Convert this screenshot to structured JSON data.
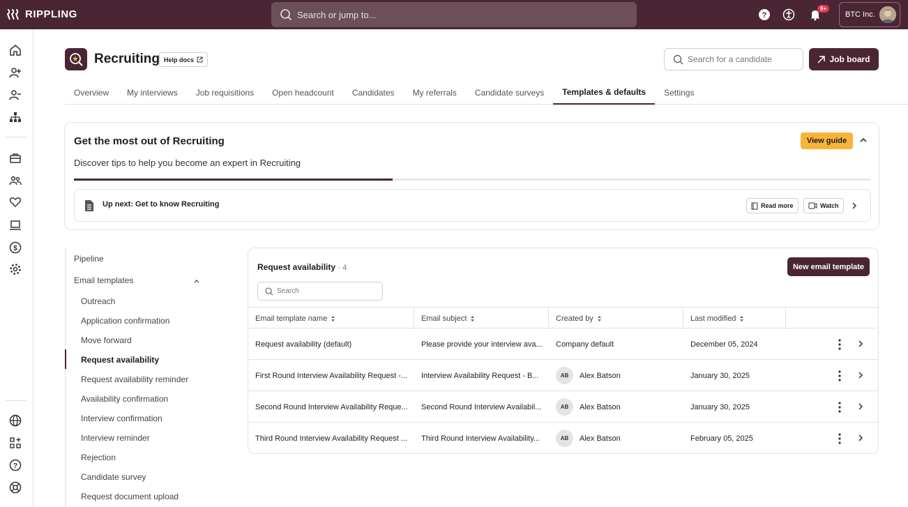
{
  "topbar": {
    "brand": "RIPPLING",
    "search_placeholder": "Search or jump to...",
    "notification_badge": "9+",
    "company": "BTC Inc."
  },
  "sidebar": {
    "icons": [
      "home-icon",
      "person-add-icon",
      "person-remove-icon",
      "org-chart-icon",
      "briefcase-icon",
      "people-icon",
      "heart-icon",
      "laptop-icon",
      "dollar-icon",
      "gear-icon",
      "globe-icon",
      "apps-add-icon",
      "help-icon",
      "support-icon"
    ]
  },
  "header": {
    "title": "Recruiting",
    "help_docs": "Help docs",
    "candidate_search_placeholder": "Search for a candidate",
    "job_board": "Job board"
  },
  "tabs": [
    {
      "label": "Overview",
      "active": false
    },
    {
      "label": "My interviews",
      "active": false
    },
    {
      "label": "Job requisitions",
      "active": false
    },
    {
      "label": "Open headcount",
      "active": false
    },
    {
      "label": "Candidates",
      "active": false
    },
    {
      "label": "My referrals",
      "active": false
    },
    {
      "label": "Candidate surveys",
      "active": false
    },
    {
      "label": "Templates & defaults",
      "active": true
    },
    {
      "label": "Settings",
      "active": false
    }
  ],
  "guide": {
    "title": "Get the most out of Recruiting",
    "subtitle": "Discover tips to help you become an expert in Recruiting",
    "view_guide": "View guide",
    "progress": 0.4,
    "up_next": "Up next: Get to know Recruiting",
    "read_more": "Read more",
    "watch": "Watch"
  },
  "leftnav": {
    "pipeline": "Pipeline",
    "email_templates": "Email templates",
    "items": [
      {
        "label": "Outreach",
        "selected": false
      },
      {
        "label": "Application confirmation",
        "selected": false
      },
      {
        "label": "Move forward",
        "selected": false
      },
      {
        "label": "Request availability",
        "selected": true
      },
      {
        "label": "Request availability reminder",
        "selected": false
      },
      {
        "label": "Availability confirmation",
        "selected": false
      },
      {
        "label": "Interview confirmation",
        "selected": false
      },
      {
        "label": "Interview reminder",
        "selected": false
      },
      {
        "label": "Rejection",
        "selected": false
      },
      {
        "label": "Candidate survey",
        "selected": false
      },
      {
        "label": "Request document upload",
        "selected": false
      }
    ]
  },
  "panel": {
    "title": "Request availability",
    "count": "· 4",
    "new_button": "New email template",
    "search_placeholder": "Search",
    "columns": [
      "Email template name",
      "Email subject",
      "Created by",
      "Last modified"
    ],
    "rows": [
      {
        "name": "Request availability (default)",
        "subject": "Please provide your interview ava...",
        "creator_initials": "",
        "creator": "Company default",
        "modified": "December 05, 2024"
      },
      {
        "name": "First Round Interview Availability Request -...",
        "subject": "Interview Availability Request - B...",
        "creator_initials": "AB",
        "creator": "Alex Batson",
        "modified": "January 30, 2025"
      },
      {
        "name": "Second Round Interview Availability Reque...",
        "subject": "Second Round Interview Availabil...",
        "creator_initials": "AB",
        "creator": "Alex Batson",
        "modified": "January 30, 2025"
      },
      {
        "name": "Third Round Interview Availability Request ...",
        "subject": "Third Round Interview Availability...",
        "creator_initials": "AB",
        "creator": "Alex Batson",
        "modified": "February 05, 2025"
      }
    ]
  },
  "colors": {
    "brand": "#4a2634",
    "accent": "#f8b438"
  }
}
